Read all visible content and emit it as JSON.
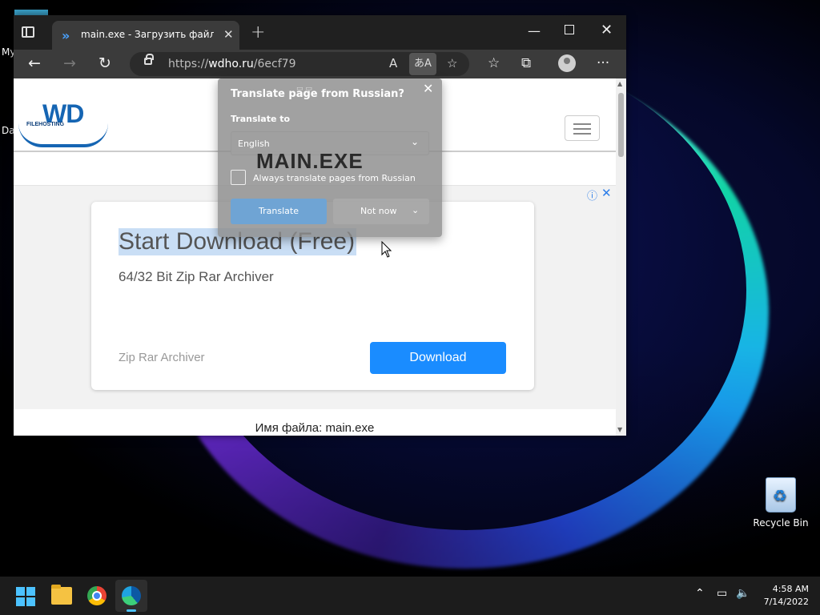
{
  "desktop": {
    "left_stub_text_1": "My",
    "left_stub_text_2": "Da",
    "recycle_bin_label": "Recycle Bin"
  },
  "browser": {
    "tab_title": "main.exe - Загрузить файл или с",
    "tab_favicon": "chevron-double-right-icon",
    "url_prefix": "https://",
    "url_domain": "wdho.ru",
    "url_path": "/6ecf79",
    "window_buttons": [
      "minimize",
      "maximize",
      "close"
    ]
  },
  "site": {
    "logo_text": "WD",
    "logo_sub": "FILEHOSTING"
  },
  "ad": {
    "title": "Start Download (Free)",
    "subtitle": "64/32 Bit Zip Rar Archiver",
    "text": "Zip Rar Archiver",
    "button": "Download",
    "accent_color": "#1a8cff"
  },
  "page": {
    "filename_label": "Имя файла",
    "filename_value": "main.exe"
  },
  "translate_popup": {
    "title": "Translate page from Russian?",
    "translate_to_label": "Translate to",
    "language_selected": "English",
    "overlay_text": "MAIN.EXE",
    "checkbox_label": "Always translate pages from Russian",
    "checkbox_checked": false,
    "translate_button": "Translate",
    "not_now_button": "Not now"
  },
  "taskbar": {
    "time": "4:58 AM",
    "date": "7/14/2022",
    "pinned": [
      "windows-start-icon",
      "file-explorer-icon",
      "chrome-icon",
      "edge-icon"
    ],
    "active_app": "edge-icon"
  }
}
